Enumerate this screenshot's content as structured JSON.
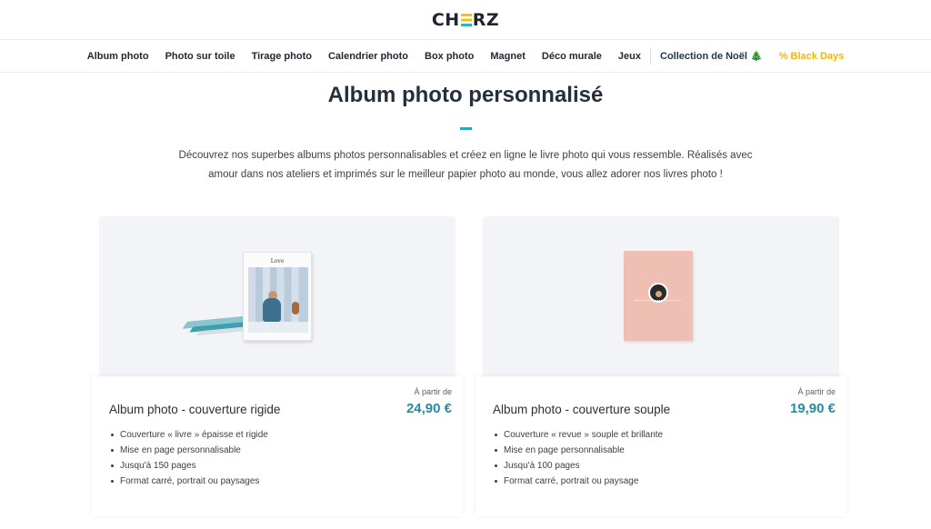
{
  "header": {
    "logo": {
      "prefix": "CH",
      "suffix": "RZ"
    }
  },
  "nav": {
    "items": [
      "Album photo",
      "Photo sur toile",
      "Tirage photo",
      "Calendrier photo",
      "Box photo",
      "Magnet",
      "Déco murale",
      "Jeux"
    ],
    "noel": "Collection de Noël 🎄",
    "black_days": "% Black Days"
  },
  "page": {
    "title": "Album photo personnalisé",
    "intro": "Découvrez nos superbes albums photos personnalisables et créez en ligne le livre photo qui vous ressemble. Réalisés avec amour dans nos ateliers et imprimés sur le meilleur papier photo au monde, vous allez adorer nos livres photo !"
  },
  "products": [
    {
      "name": "Album photo - couverture rigide",
      "from_label": "À partir de",
      "price": "24,90 €",
      "features": [
        "Couverture « livre » épaisse et rigide",
        "Mise en page personnalisable",
        "Jusqu'à 150 pages",
        "Format carré, portrait ou paysages"
      ],
      "cover_title": "Love"
    },
    {
      "name": "Album photo - couverture souple",
      "from_label": "À partir de",
      "price": "19,90 €",
      "features": [
        "Couverture « revue » souple et brillante",
        "Mise en page personnalisable",
        "Jusqu'à 100 pages",
        "Format carré, portrait ou paysage"
      ]
    }
  ],
  "colors": {
    "accent": "#2aa7bf",
    "price": "#218ea3",
    "black_days": "#f2b705",
    "logo_yellow": "#f5c400",
    "background_card": "#f2f4f8"
  }
}
